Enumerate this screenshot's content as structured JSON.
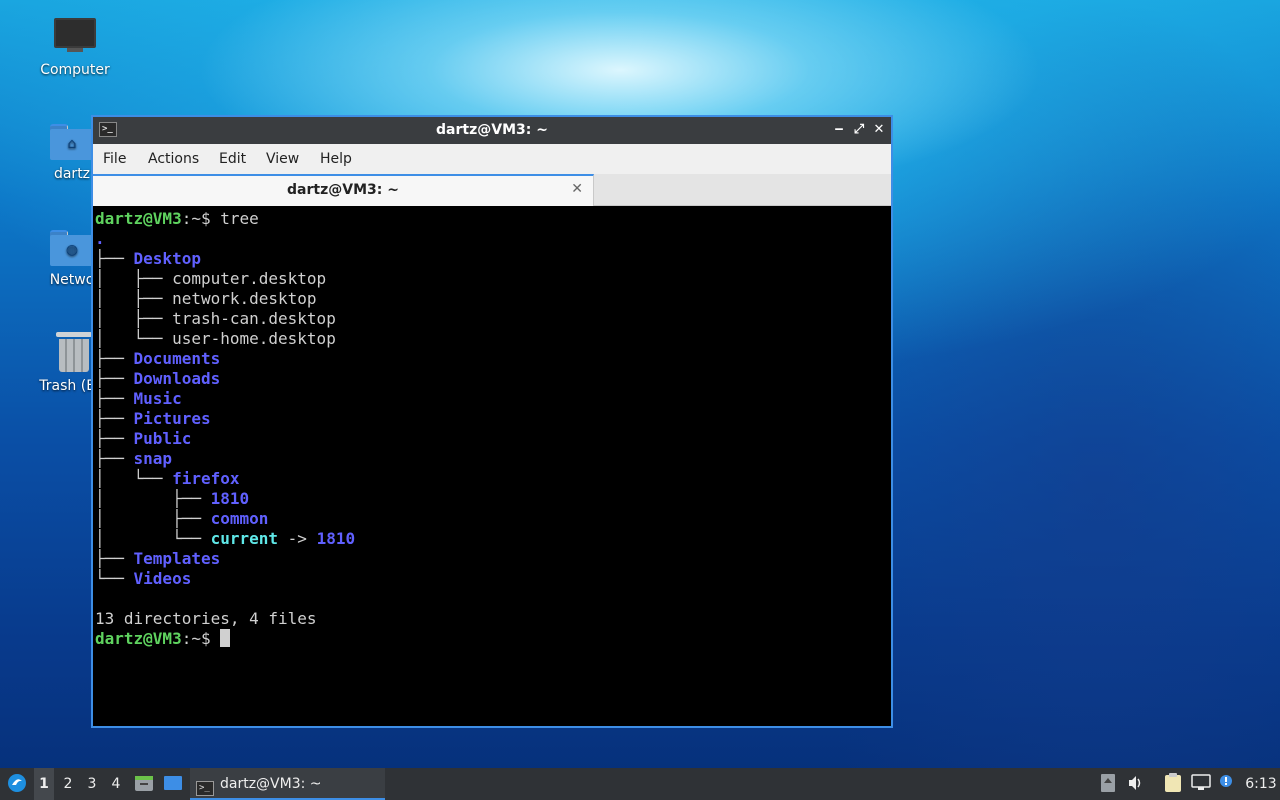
{
  "desktop": {
    "icons": [
      {
        "label": "Computer",
        "icon": "computer-icon"
      },
      {
        "label": "dartz",
        "icon": "home-folder-icon"
      },
      {
        "label": "Netwo",
        "icon": "network-folder-icon"
      },
      {
        "label": "Trash (Em",
        "icon": "trash-icon"
      }
    ]
  },
  "window": {
    "title": "dartz@VM3: ~",
    "controls": {
      "minimize": "‒",
      "maximize": "⤢",
      "close": "✕"
    },
    "menu": [
      "File",
      "Actions",
      "Edit",
      "View",
      "Help"
    ],
    "tab": {
      "label": "dartz@VM3: ~",
      "close": "✕"
    }
  },
  "terminal": {
    "prompt_user": "dartz@VM3",
    "prompt_sep": ":~$ ",
    "command": "tree",
    "dot": ".",
    "tree": [
      {
        "prefix": "├── ",
        "name": "Desktop",
        "kind": "dir"
      },
      {
        "prefix": "│   ├── ",
        "name": "computer.desktop",
        "kind": "file"
      },
      {
        "prefix": "│   ├── ",
        "name": "network.desktop",
        "kind": "file"
      },
      {
        "prefix": "│   ├── ",
        "name": "trash-can.desktop",
        "kind": "file"
      },
      {
        "prefix": "│   └── ",
        "name": "user-home.desktop",
        "kind": "file"
      },
      {
        "prefix": "├── ",
        "name": "Documents",
        "kind": "dir"
      },
      {
        "prefix": "├── ",
        "name": "Downloads",
        "kind": "dir"
      },
      {
        "prefix": "├── ",
        "name": "Music",
        "kind": "dir"
      },
      {
        "prefix": "├── ",
        "name": "Pictures",
        "kind": "dir"
      },
      {
        "prefix": "├── ",
        "name": "Public",
        "kind": "dir"
      },
      {
        "prefix": "├── ",
        "name": "snap",
        "kind": "dir"
      },
      {
        "prefix": "│   └── ",
        "name": "firefox",
        "kind": "dir"
      },
      {
        "prefix": "│       ├── ",
        "name": "1810",
        "kind": "dir"
      },
      {
        "prefix": "│       ├── ",
        "name": "common",
        "kind": "dir"
      },
      {
        "prefix": "│       └── ",
        "name": "current",
        "kind": "link",
        "arrow": " -> ",
        "target": "1810"
      },
      {
        "prefix": "├── ",
        "name": "Templates",
        "kind": "dir"
      },
      {
        "prefix": "└── ",
        "name": "Videos",
        "kind": "dir"
      }
    ],
    "summary": "13 directories, 4 files",
    "colors": {
      "prompt": "#5fd35f",
      "dir": "#6060ff",
      "link": "#5fe8e8",
      "text": "#d0d0d0"
    }
  },
  "taskbar": {
    "start_icon": "lubuntu-start-icon",
    "workspaces": [
      "1",
      "2",
      "3",
      "4"
    ],
    "active_workspace": "1",
    "task": {
      "label": "dartz@VM3: ~"
    },
    "tray_icons": [
      "update-icon",
      "volume-icon",
      "clipboard-icon",
      "network-icon",
      "notification-icon"
    ],
    "clock": "6:13"
  }
}
